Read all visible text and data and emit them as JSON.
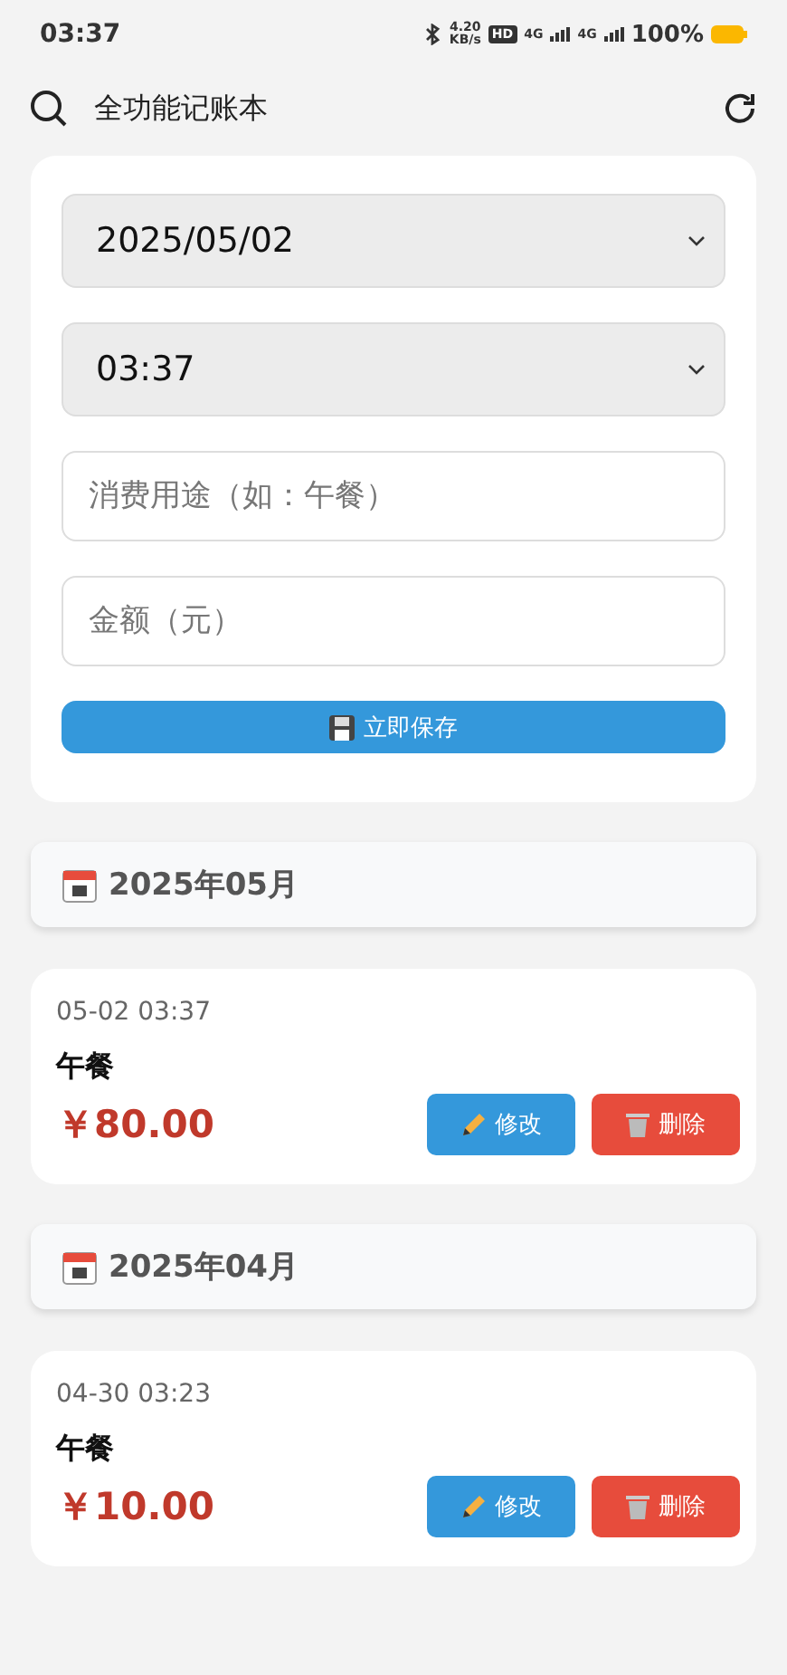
{
  "status_bar": {
    "time": "03:37",
    "net_speed": "4.20",
    "net_unit": "KB/s",
    "hd_badge": "HD",
    "sim_1": "4G",
    "sim_2": "4G",
    "battery": "100%"
  },
  "header": {
    "title": "全功能记账本"
  },
  "form": {
    "date": {
      "value": "2025/05/02"
    },
    "time": {
      "value": "03:37"
    },
    "purpose": {
      "placeholder": "消费用途（如：午餐）"
    },
    "amount": {
      "placeholder": "金额（元）"
    },
    "save_button": "立即保存"
  },
  "months": [
    {
      "title": "2025年05月",
      "records": [
        {
          "datetime": "05-02 03:37",
          "purpose": "午餐",
          "amount": "￥80.00",
          "edit_label": "修改",
          "delete_label": "删除"
        }
      ]
    },
    {
      "title": "2025年04月",
      "records": [
        {
          "datetime": "04-30 03:23",
          "purpose": "午餐",
          "amount": "￥10.00",
          "edit_label": "修改",
          "delete_label": "删除"
        }
      ]
    }
  ]
}
